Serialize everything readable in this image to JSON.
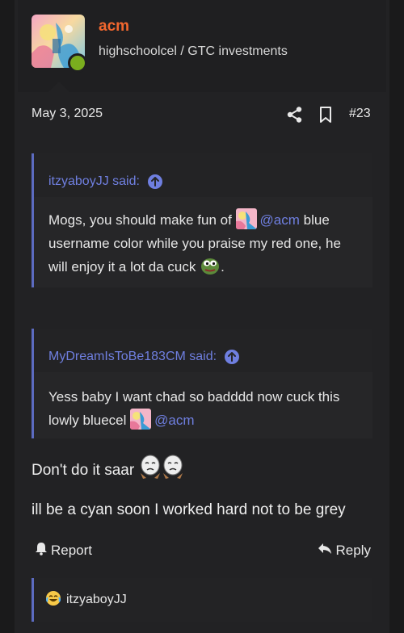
{
  "user": {
    "name": "acm",
    "title": "highschoolcel / GTC investments",
    "avatar_icon": "album-art-avatar",
    "online": true
  },
  "post": {
    "date": "May 3, 2025",
    "number": "#23",
    "share_icon": "share-icon",
    "bookmark_icon": "bookmark-icon"
  },
  "quotes": [
    {
      "author": "itzyaboyJJ said:",
      "text_before": "Mogs, you should make fun of",
      "mention": "@acm",
      "text_after": "blue username color while you praise my red one, he will enjoy it a lot da cuck",
      "trailing": ".",
      "emoji": "pepe-frog-emoji"
    },
    {
      "author": "MyDreamIsToBe183CM said:",
      "text_before": "Yess baby I want chad so badddd now cuck this lowly bluecel",
      "mention": "@acm"
    }
  ],
  "reply": {
    "line1": "Don't do it saar",
    "line1_emoji": "crying-wojak-emoji",
    "line2": "ill be a cyan soon I worked hard not to be grey"
  },
  "actions": {
    "report": "Report",
    "reply": "Reply"
  },
  "reactions": {
    "user": "itzyaboyJJ",
    "emoji": "laughing-crying-emoji"
  },
  "colors": {
    "username": "#f2672e",
    "mention": "#6f7fe0",
    "quote_border": "#5c6bc0",
    "online": "#7aad1e"
  }
}
